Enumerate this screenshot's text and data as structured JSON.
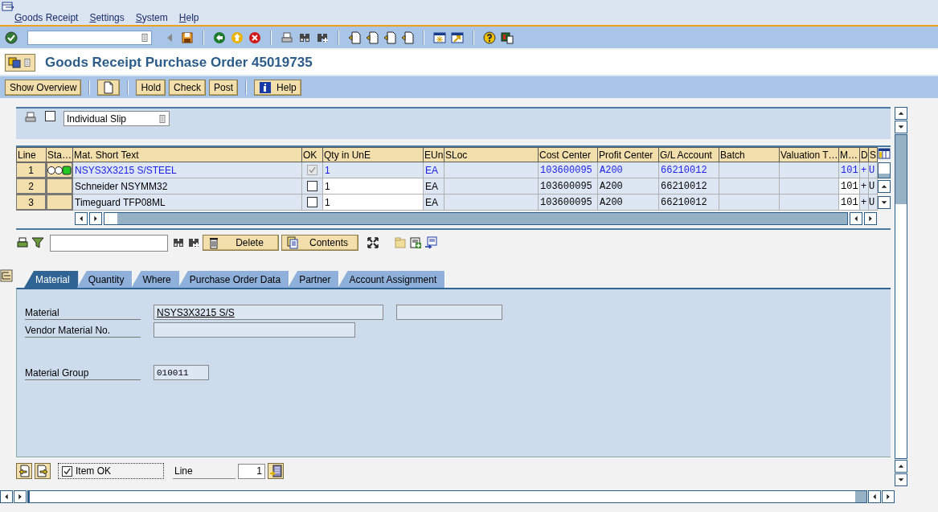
{
  "menu": [
    {
      "label": "Goods Receipt"
    },
    {
      "label": "Settings"
    },
    {
      "label": "System"
    },
    {
      "label": "Help"
    }
  ],
  "title": "Goods Receipt Purchase Order 45019735",
  "app_toolbar": [
    {
      "kind": "text",
      "label": "Show Overview"
    },
    {
      "kind": "icon"
    },
    {
      "kind": "text",
      "label": "Hold"
    },
    {
      "kind": "text",
      "label": "Check"
    },
    {
      "kind": "text",
      "label": "Post"
    },
    {
      "kind": "icon_text",
      "label": "Help"
    }
  ],
  "print_options": {
    "slip_checked": false,
    "slip_type": "Individual Slip"
  },
  "table": {
    "columns": [
      "Line",
      "Sta…",
      "Mat. Short Text",
      "OK",
      "Qty in UnE",
      "EUn",
      "SLoc",
      "Cost Center",
      "Profit Center",
      "G/L Account",
      "Batch",
      "Valuation T…",
      "M…",
      "D",
      "S"
    ],
    "rows": [
      {
        "selected": true,
        "line": "1",
        "traffic_light": true,
        "material": "NSYS3X3215 S/STEEL",
        "ok": {
          "checked": true,
          "disabled": true
        },
        "qty": "1",
        "unit": "EA",
        "cost_center": "103600095",
        "profit_center": "A200",
        "gl_account": "66210012",
        "movement_type": "101",
        "debit_credit": "+",
        "s": "U"
      },
      {
        "selected": false,
        "line": "2",
        "traffic_light": false,
        "material": "Schneider NSYMM32",
        "ok": {
          "checked": false,
          "disabled": false
        },
        "qty": "1",
        "unit": "EA",
        "cost_center": "103600095",
        "profit_center": "A200",
        "gl_account": "66210012",
        "movement_type": "101",
        "debit_credit": "+",
        "s": "U"
      },
      {
        "selected": false,
        "line": "3",
        "traffic_light": false,
        "material": "Timeguard TFP08ML",
        "ok": {
          "checked": false,
          "disabled": false
        },
        "qty": "1",
        "unit": "EA",
        "cost_center": "103600095",
        "profit_center": "A200",
        "gl_account": "66210012",
        "movement_type": "101",
        "debit_credit": "+",
        "s": "U"
      }
    ]
  },
  "item_toolbar": {
    "buttons": [
      {
        "label": "Delete"
      },
      {
        "label": "Contents"
      }
    ]
  },
  "tabs": [
    {
      "label": "Material",
      "selected": true
    },
    {
      "label": "Quantity",
      "selected": false
    },
    {
      "label": "Where",
      "selected": false
    },
    {
      "label": "Purchase Order Data",
      "selected": false
    },
    {
      "label": "Partner",
      "selected": false
    },
    {
      "label": "Account Assignment",
      "selected": false
    }
  ],
  "fields": [
    {
      "kind": "pair",
      "label": "Material",
      "value": "NSYS3X3215 S/S"
    },
    {
      "kind": "text",
      "label": "Vendor Material No."
    },
    {
      "kind": "short",
      "label": "Material Group",
      "value": "010011"
    }
  ],
  "footer": {
    "item_ok": true,
    "item_ok_label": "Item OK",
    "line_label": "Line",
    "line_value": "1"
  }
}
